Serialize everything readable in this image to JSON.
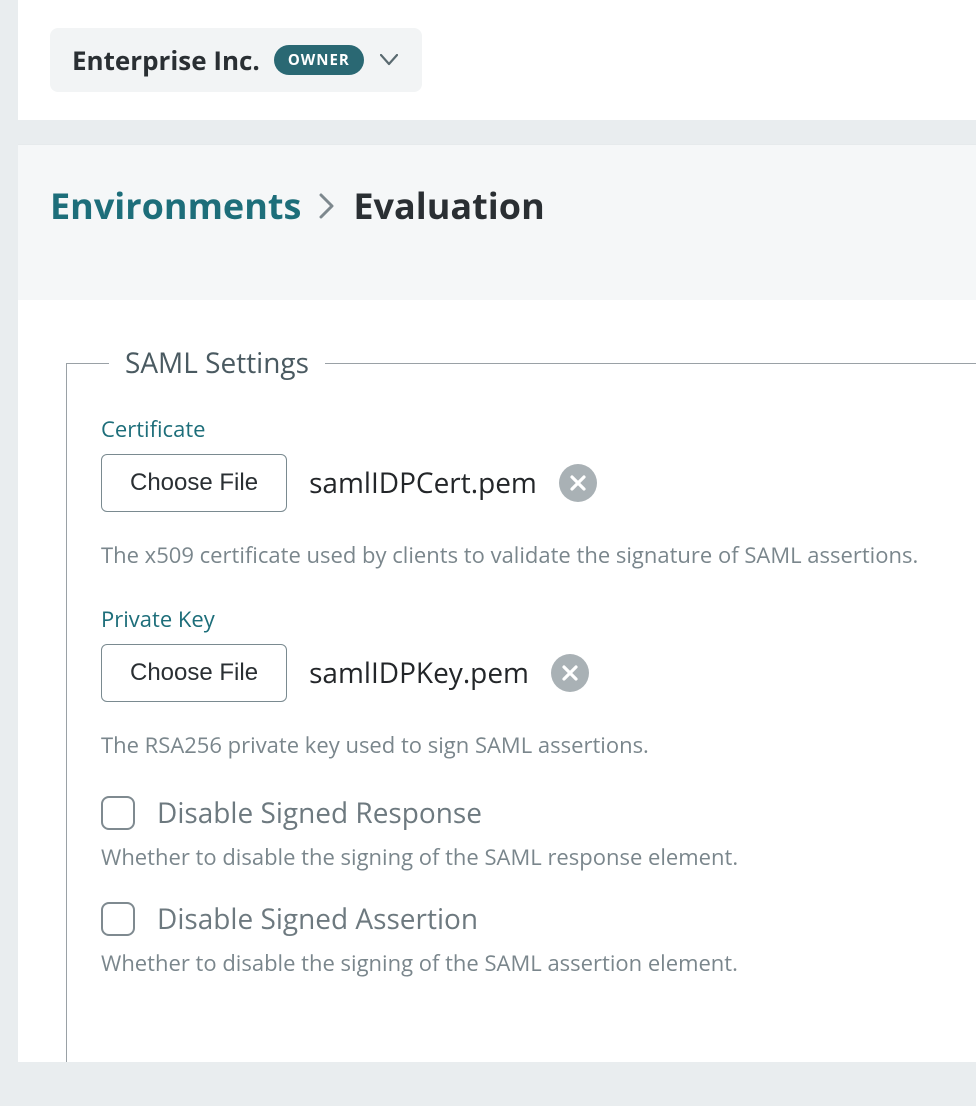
{
  "org": {
    "name": "Enterprise Inc.",
    "role_badge": "OWNER"
  },
  "breadcrumb": {
    "root": "Environments",
    "current": "Evaluation"
  },
  "saml": {
    "legend": "SAML Settings",
    "certificate": {
      "label": "Certificate",
      "button": "Choose File",
      "file_name": "samlIDPCert.pem",
      "help": "The x509 certificate used by clients to validate the signature of SAML assertions."
    },
    "private_key": {
      "label": "Private Key",
      "button": "Choose File",
      "file_name": "samlIDPKey.pem",
      "help": "The RSA256 private key used to sign SAML assertions."
    },
    "disable_signed_response": {
      "label": "Disable Signed Response",
      "help": "Whether to disable the signing of the SAML response element.",
      "checked": false
    },
    "disable_signed_assertion": {
      "label": "Disable Signed Assertion",
      "help": "Whether to disable the signing of the SAML assertion element.",
      "checked": false
    }
  }
}
